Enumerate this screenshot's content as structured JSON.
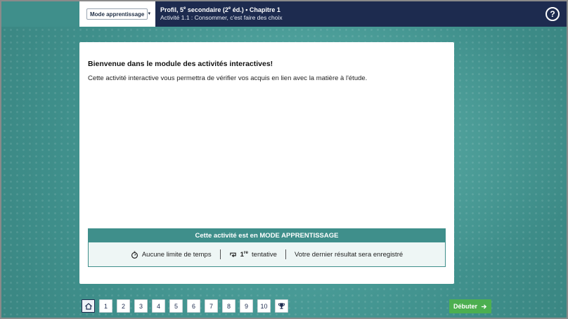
{
  "header": {
    "mode_selector": "Mode apprentissage",
    "title_prefix": "Profil, 5",
    "title_sup": "e",
    "title_suffix": " secondaire (2",
    "title_sup2": "e",
    "title_end": " éd.) • Chapitre 1",
    "subtitle": "Activité 1.1 : Consommer, c'est faire des choix",
    "help_icon_glyph": "?"
  },
  "main": {
    "welcome_title": "Bienvenue dans le module des activités interactives!",
    "welcome_text": "Cette activité interactive vous permettra de vérifier vos acquis en lien avec la matière à l'étude."
  },
  "mode_panel": {
    "title": "Cette activité est en MODE APPRENTISSAGE",
    "time_text": "Aucune limite de temps",
    "attempt_num": "1",
    "attempt_sup": "re",
    "attempt_text": "tentative",
    "result_text": "Votre dernier résultat sera enregistré"
  },
  "pager": {
    "pages": [
      "1",
      "2",
      "3",
      "4",
      "5",
      "6",
      "7",
      "8",
      "9",
      "10"
    ]
  },
  "footer": {
    "start_label": "Débuter"
  },
  "colors": {
    "teal": "#3f8f8b",
    "navy": "#1d2b4f",
    "green": "#4caf50"
  },
  "icons": [
    "home-icon",
    "trophy-icon",
    "arrow-right-icon",
    "stopwatch-icon",
    "retry-icon",
    "help-icon",
    "caret-down-icon"
  ]
}
